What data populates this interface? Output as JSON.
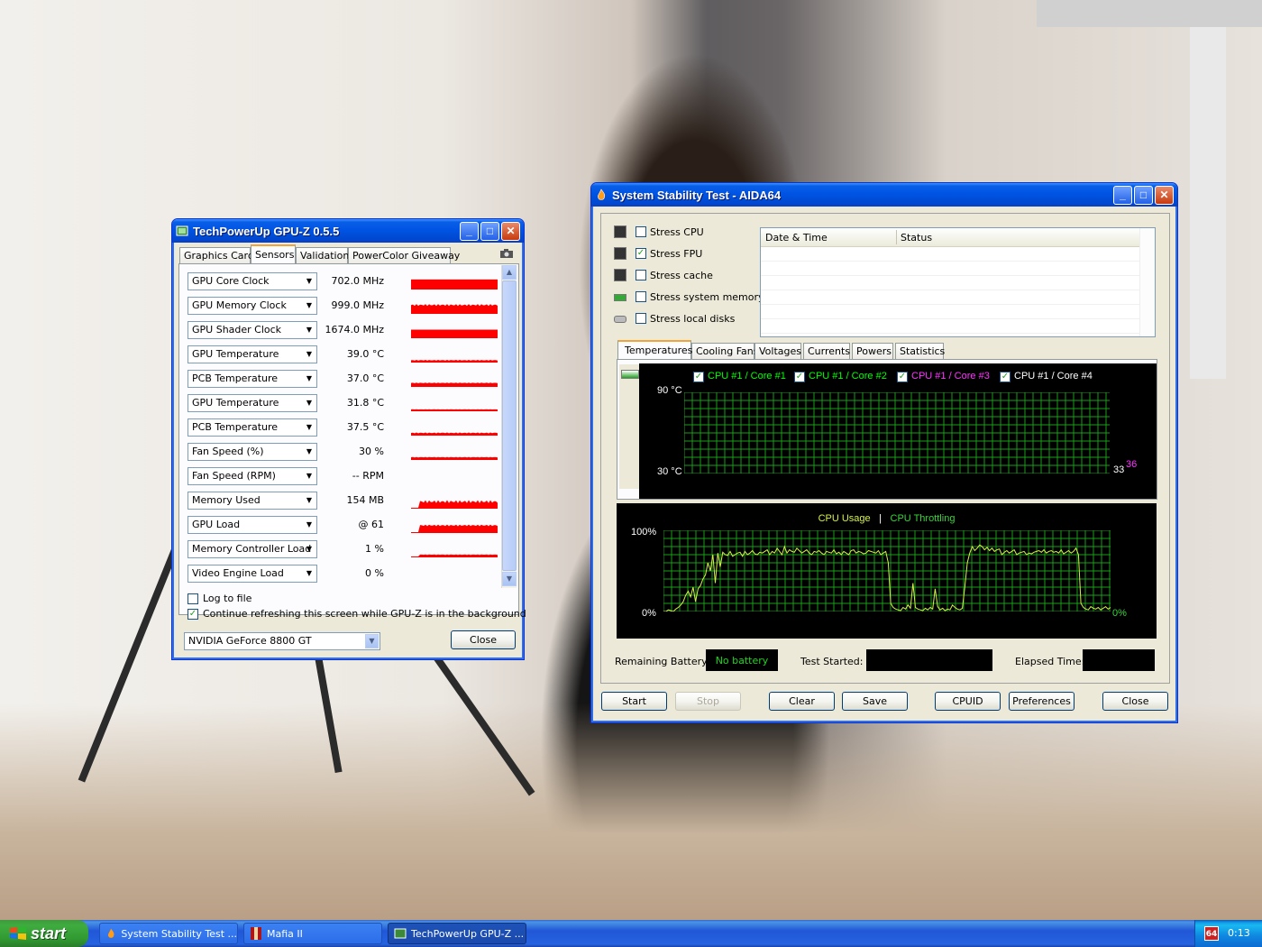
{
  "gpuz": {
    "title": "TechPowerUp GPU-Z 0.5.5",
    "tabs": [
      "Graphics Card",
      "Sensors",
      "Validation",
      "PowerColor Giveaway"
    ],
    "active_tab": "Sensors",
    "sensors": [
      {
        "name": "GPU Core Clock",
        "value": "702.0 MHz",
        "fill": 1.0
      },
      {
        "name": "GPU Memory Clock",
        "value": "999.0 MHz",
        "fill": 0.65
      },
      {
        "name": "GPU Shader Clock",
        "value": "1674.0 MHz",
        "fill": 0.85
      },
      {
        "name": "GPU Temperature",
        "value": "39.0 °C",
        "fill": 0.12
      },
      {
        "name": "PCB Temperature",
        "value": "37.0 °C",
        "fill": 0.25
      },
      {
        "name": "GPU Temperature",
        "value": "31.8 °C",
        "fill": 0.08
      },
      {
        "name": "PCB Temperature",
        "value": "37.5 °C",
        "fill": 0.15
      },
      {
        "name": "Fan Speed (%)",
        "value": "30 %",
        "fill": 0.15
      },
      {
        "name": "Fan Speed (RPM)",
        "value": "-- RPM",
        "fill": 0.0
      },
      {
        "name": "Memory Used",
        "value": "154 MB",
        "fill": 0.5
      },
      {
        "name": "GPU Load",
        "value": "@ 61",
        "fill": 0.55
      },
      {
        "name": "Memory Controller Load",
        "value": "1 %",
        "fill": 0.15
      },
      {
        "name": "Video Engine Load",
        "value": "0 %",
        "fill": 0.0
      }
    ],
    "log_to_file": "Log to file",
    "log_checked": false,
    "continue_refresh": "Continue refreshing this screen while GPU-Z is in the background",
    "continue_checked": true,
    "card_select": "NVIDIA GeForce 8800 GT",
    "close_label": "Close",
    "graph_color": "#ff0000"
  },
  "aida": {
    "title": "System Stability Test - AIDA64",
    "stress_options": [
      {
        "label": "Stress CPU",
        "checked": false
      },
      {
        "label": "Stress FPU",
        "checked": true
      },
      {
        "label": "Stress cache",
        "checked": false
      },
      {
        "label": "Stress system memory",
        "checked": false
      },
      {
        "label": "Stress local disks",
        "checked": false
      }
    ],
    "log_columns": [
      "Date & Time",
      "Status"
    ],
    "tabs": [
      "Temperatures",
      "Cooling Fans",
      "Voltages",
      "Currents",
      "Powers",
      "Statistics"
    ],
    "active_tab": "Temperatures",
    "temp_legend": [
      {
        "label": "CPU #1 / Core #1",
        "color": "#00ff00"
      },
      {
        "label": "CPU #1 / Core #2",
        "color": "#00ff00"
      },
      {
        "label": "CPU #1 / Core #3",
        "color": "#ff33ff"
      },
      {
        "label": "CPU #1 / Core #4",
        "color": "#ffffff"
      }
    ],
    "temp_axis_top": "90 °C",
    "temp_axis_bottom": "30 °C",
    "temp_readout_a": "33",
    "temp_readout_b": "36",
    "usage_title": "CPU Usage",
    "usage_sep": "|",
    "throttle_title": "CPU Throttling",
    "usage_axis_top": "100%",
    "usage_axis_bottom": "0%",
    "usage_readout": "0%",
    "usage_series": [
      0,
      0,
      2,
      1,
      0,
      3,
      5,
      8,
      12,
      20,
      25,
      18,
      30,
      12,
      28,
      32,
      40,
      45,
      60,
      50,
      70,
      35,
      72,
      55,
      73,
      70,
      69,
      74,
      68,
      70,
      72,
      73,
      68,
      74,
      70,
      72,
      75,
      71,
      70,
      73,
      72,
      74,
      76,
      70,
      74,
      72,
      78,
      74,
      70,
      80,
      72,
      76,
      74,
      73,
      78,
      75,
      72,
      74,
      76,
      72,
      70,
      74,
      73,
      75,
      72,
      70,
      74,
      73,
      72,
      76,
      71,
      73,
      70,
      74,
      72,
      70,
      75,
      76,
      72,
      74,
      73,
      71,
      72,
      75,
      74,
      73,
      72,
      75,
      70,
      72,
      74,
      60,
      10,
      5,
      3,
      2,
      1,
      5,
      3,
      8,
      4,
      35,
      5,
      3,
      2,
      1,
      4,
      2,
      5,
      3,
      28,
      6,
      2,
      4,
      1,
      3,
      2,
      8,
      5,
      3,
      2,
      4,
      30,
      60,
      72,
      80,
      75,
      78,
      82,
      80,
      76,
      79,
      75,
      78,
      74,
      76,
      77,
      70,
      73,
      75,
      72,
      74,
      76,
      70,
      72,
      73,
      74,
      70,
      72,
      71,
      73,
      74,
      75,
      73,
      76,
      72,
      74,
      75,
      73,
      74,
      72,
      76,
      71,
      73,
      75,
      72,
      74,
      78,
      70,
      10,
      5,
      3,
      2,
      6,
      4,
      3,
      5,
      2,
      4,
      6,
      3,
      5
    ],
    "remaining_battery_label": "Remaining Battery:",
    "remaining_battery_value": "No battery",
    "test_started_label": "Test Started:",
    "elapsed_time_label": "Elapsed Time:",
    "buttons": {
      "start": "Start",
      "stop": "Stop",
      "clear": "Clear",
      "save": "Save",
      "cpuid": "CPUID",
      "preferences": "Preferences",
      "close": "Close"
    },
    "grid_color": "#1a9c1a",
    "graph_line_color": "#d6f04a"
  },
  "taskbar": {
    "start_label": "start",
    "items": [
      {
        "label": "System Stability Test ...",
        "active": false
      },
      {
        "label": "Mafia II",
        "active": false
      },
      {
        "label": "TechPowerUp GPU-Z ...",
        "active": true
      }
    ],
    "clock": "0:13",
    "tray_icon": "aida64-icon"
  }
}
